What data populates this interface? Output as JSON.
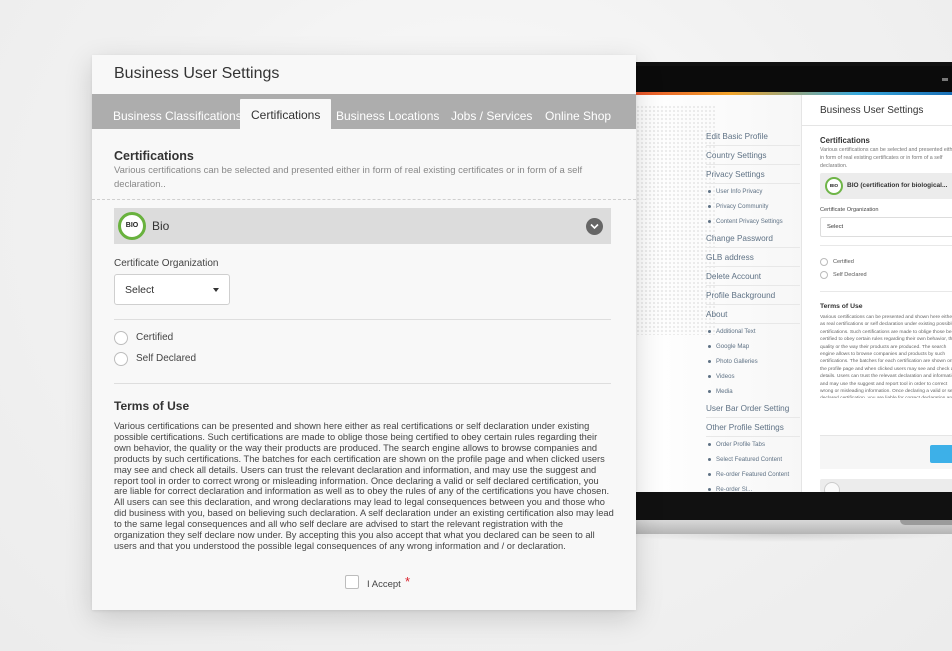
{
  "colors": {
    "tab_bar": "#adadad",
    "bio_badge_ring": "#69b23e",
    "required_star": "#d9232e",
    "laptop_accent_button": "#3db0e8"
  },
  "panel": {
    "title": "Business User Settings",
    "tabs": [
      {
        "label": "Business Classifications",
        "active": false
      },
      {
        "label": "Certifications",
        "active": true
      },
      {
        "label": "Business Locations",
        "active": false
      },
      {
        "label": "Jobs / Services",
        "active": false
      },
      {
        "label": "Online Shop",
        "active": false
      }
    ],
    "certifications": {
      "heading": "Certifications",
      "description": "Various certifications can be selected and presented either in form of real existing certificates or in form of a self declaration..",
      "selected_certificate": {
        "badge_text": "BIO",
        "label": "Bio",
        "expand_icon": "chevron-down-icon"
      },
      "organization_label": "Certificate Organization",
      "organization_select_value": "Select",
      "radio_options": [
        "Certified",
        "Self Declared"
      ]
    },
    "terms": {
      "heading": "Terms of Use",
      "body": "Various certifications can be presented and shown here either as real certifications or self declaration under existing possible certifications. Such certifications are made to oblige those being certified to obey certain rules regarding their own behavior, the quality or the way their products are produced. The search engine allows to browse companies and products by such certifications. The batches for each certification are shown on the profile page and when clicked users may see and check all details. Users can trust the relevant declaration and information, and may use the suggest and report tool in order to correct wrong or misleading information. Once declaring a valid or self declared certification, you are liable for correct declaration and information as well as to obey the rules of any of the certifications you have chosen. All users can see this declaration, and wrong declarations may lead to legal consequences between you and those who did business with you, based on believing such declaration. A self declaration under an existing certification also may lead to the same legal consequences and all who self declare are advised to start the relevant registration with the organization they self declare now under. By accepting this you also accept that what you declared can be seen to all users and that you understood the possible legal consequences of any wrong information and / or declaration.",
      "accept_label": "I Accept",
      "required_marker": "*"
    }
  },
  "laptop": {
    "sidebar": [
      {
        "label": "Edit Basic Profile",
        "sub": []
      },
      {
        "label": "Country Settings",
        "sub": []
      },
      {
        "label": "Privacy Settings",
        "sub": [
          "User Info Privacy",
          "Privacy Community",
          "Content Privacy Settings"
        ]
      },
      {
        "label": "Change Password",
        "sub": []
      },
      {
        "label": "GLB address",
        "sub": []
      },
      {
        "label": "Delete Account",
        "sub": []
      },
      {
        "label": "Profile Background",
        "sub": []
      },
      {
        "label": "About",
        "sub": [
          "Additional Text",
          "Google Map",
          "Photo Galleries",
          "Videos",
          "Media"
        ]
      },
      {
        "label": "User Bar Order Setting",
        "sub": []
      },
      {
        "label": "Other Profile Settings",
        "sub": [
          "Order Profile Tabs",
          "Select Featured Content",
          "Re-order Featured Content",
          "Re-order Sl..."
        ]
      }
    ],
    "main": {
      "title": "Business User Settings",
      "cert_heading": "Certifications",
      "cert_description": "Various certifications can be selected and presented either in form of real existing certificates or in form of a self declaration.",
      "bio_badge": "BIO",
      "bio_label": "BIO (certification for biological...",
      "org_label": "Certificate Organization",
      "select_value": "Select",
      "radio_options": [
        "Certified",
        "Self Declared"
      ],
      "terms_heading": "Terms of Use",
      "terms_excerpt": "Various certifications can be presented and shown here either as real certifications or self declaration under existing possible certifications. Such certifications are made to oblige those being certified to obey certain rules regarding their own behavior, the quality or the way their products are produced. The search engine allows to browse companies and products by such certifications. The batches for each certification are shown on the profile page and when clicked users may see and check all details. Users can trust the relevant declaration and information, and may use the suggest and report tool in order to correct wrong or misleading information. Once declaring a valid or self declared certification, you are liable for correct declaration and information as well as to obey the rules of any of the certifications you have chosen. All users can see this declaration and wrong declarations may lead to legal consequences between you and those who did business with you, based on believing such declaration. A self declaration under an existing certification also may lead to the same legal consequences and all who self declare are advised to start the relevant registration with the organization they self declare under. By accepting this you also accept that what you declared can be seen to all users and that you understood the possible legal consequences of any wrong information and / or declaration."
    }
  }
}
